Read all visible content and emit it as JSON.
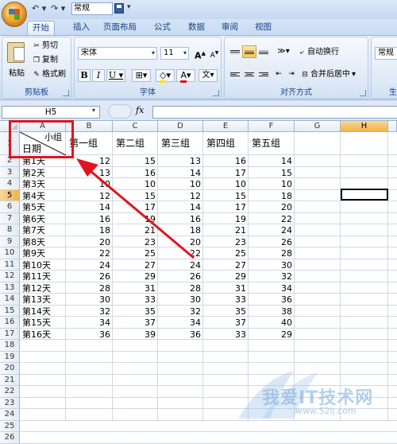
{
  "titlebar": {
    "style_value": "常规"
  },
  "tabs": [
    "开始",
    "插入",
    "页面布局",
    "公式",
    "数据",
    "审阅",
    "视图"
  ],
  "clipboard": {
    "paste": "粘贴",
    "cut": "剪切",
    "copy": "复制",
    "format_painter": "格式刷",
    "label": "剪贴板"
  },
  "font": {
    "name": "宋体",
    "size": "11",
    "grow": "A",
    "shrink": "A",
    "bold": "B",
    "italic": "I",
    "underline": "U",
    "font_color": "A",
    "phonetic": "文",
    "label": "字体"
  },
  "alignment": {
    "wrap_text": "自动换行",
    "merge_center": "合并后居中",
    "label": "对齐方式"
  },
  "number": {
    "format": "常规",
    "label_partial": "生"
  },
  "formula_bar": {
    "name_box": "H5",
    "fx": "fx",
    "value": ""
  },
  "columns": [
    "A",
    "B",
    "C",
    "D",
    "E",
    "F",
    "G",
    "H"
  ],
  "active_column": "H",
  "active_row": "5",
  "header_cell": {
    "top_right": "小组",
    "bottom_left": "日期"
  },
  "group_headers": [
    "第一组",
    "第二组",
    "第三组",
    "第四组",
    "第五组"
  ],
  "rows": [
    {
      "row": "2",
      "label": "第1天",
      "values": [
        "12",
        "15",
        "13",
        "16",
        "14"
      ]
    },
    {
      "row": "3",
      "label": "第2天",
      "values": [
        "13",
        "16",
        "14",
        "17",
        "15"
      ]
    },
    {
      "row": "4",
      "label": "第3天",
      "values": [
        "10",
        "10",
        "10",
        "10",
        "10"
      ]
    },
    {
      "row": "5",
      "label": "第4天",
      "values": [
        "12",
        "15",
        "12",
        "15",
        "18"
      ]
    },
    {
      "row": "6",
      "label": "第5天",
      "values": [
        "14",
        "17",
        "14",
        "17",
        "20"
      ]
    },
    {
      "row": "7",
      "label": "第6天",
      "values": [
        "16",
        "19",
        "16",
        "19",
        "22"
      ]
    },
    {
      "row": "8",
      "label": "第7天",
      "values": [
        "18",
        "21",
        "18",
        "21",
        "24"
      ]
    },
    {
      "row": "9",
      "label": "第8天",
      "values": [
        "20",
        "23",
        "20",
        "23",
        "26"
      ]
    },
    {
      "row": "10",
      "label": "第9天",
      "values": [
        "22",
        "25",
        "22",
        "25",
        "28"
      ]
    },
    {
      "row": "11",
      "label": "第10天",
      "values": [
        "24",
        "27",
        "24",
        "27",
        "30"
      ]
    },
    {
      "row": "12",
      "label": "第11天",
      "values": [
        "26",
        "29",
        "26",
        "29",
        "32"
      ]
    },
    {
      "row": "13",
      "label": "第12天",
      "values": [
        "28",
        "31",
        "28",
        "31",
        "34"
      ]
    },
    {
      "row": "14",
      "label": "第13天",
      "values": [
        "30",
        "33",
        "30",
        "33",
        "36"
      ]
    },
    {
      "row": "15",
      "label": "第14天",
      "values": [
        "32",
        "35",
        "32",
        "35",
        "38"
      ]
    },
    {
      "row": "16",
      "label": "第15天",
      "values": [
        "34",
        "37",
        "34",
        "37",
        "40"
      ]
    },
    {
      "row": "17",
      "label": "第16天",
      "values": [
        "36",
        "39",
        "36",
        "33",
        "29"
      ]
    }
  ],
  "empty_rows": [
    "18",
    "19",
    "20",
    "21",
    "22",
    "23",
    "24",
    "25",
    "26"
  ],
  "watermark": {
    "text": "我爱IT技术网",
    "url": "www.52ij.com"
  },
  "colors": {
    "annotation": "#e0141e",
    "active_header": "#f1b348",
    "ribbon_text": "#15428b"
  }
}
